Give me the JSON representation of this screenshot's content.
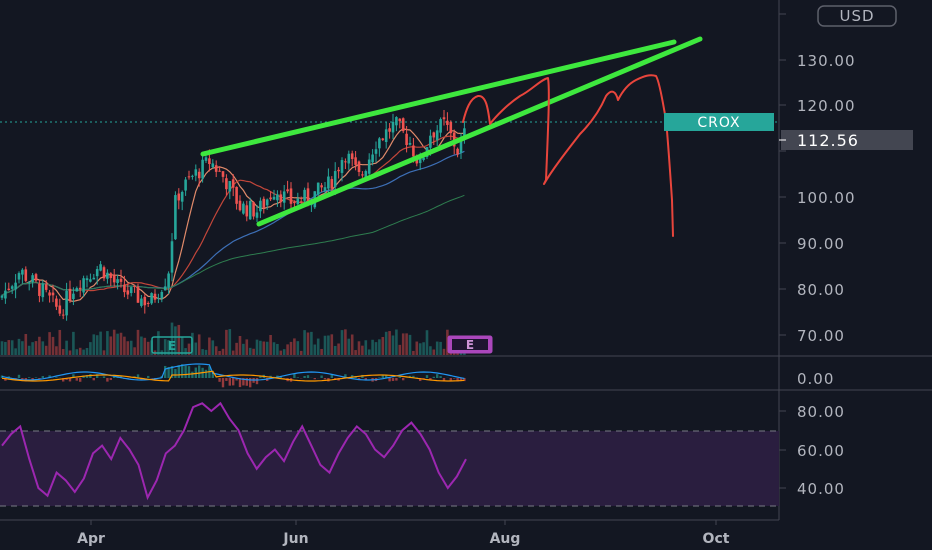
{
  "currency": "USD",
  "ticker_label": "CROX",
  "last_price": "112.56",
  "earnings_marker": "E",
  "colors": {
    "background": "#131722",
    "up": "#26a69a",
    "down": "#ef5350",
    "wedge": "#3ee83e",
    "projection": "#e8453c",
    "ticker_bg": "#26a69a",
    "rsi": "#9c27b0",
    "rsi_band": "#2a1e3f",
    "ma_fast": "#e08a6a",
    "ma_mid": "#c2463a",
    "ma_blue": "#3d6fb6",
    "ma_slow": "#2e7d4f",
    "earnings_green": "#26a69a",
    "earnings_purple": "#ab47bc"
  },
  "chart_data": [
    {
      "type": "candlestick",
      "price_axis": {
        "ticks": [
          "130.00",
          "120.00",
          "110.00",
          "100.00",
          "90.00",
          "80.00",
          "70.00"
        ],
        "range": [
          65,
          142
        ]
      },
      "time_axis": [
        "Apr",
        "Jun",
        "Aug",
        "Oct"
      ],
      "last_value": 112.56,
      "indicators": [
        "moving averages",
        "volume"
      ],
      "annotations": [
        "rising wedge trendlines",
        "hand-drawn projected price path"
      ]
    },
    {
      "type": "line",
      "indicator": "MACD",
      "axis_tick": "0.00"
    },
    {
      "type": "line",
      "indicator": "RSI",
      "axis_ticks": [
        "80.00",
        "60.00",
        "40.00"
      ],
      "range": [
        25,
        90
      ],
      "band": [
        30,
        70
      ],
      "values": [
        62,
        68,
        72,
        55,
        40,
        36,
        48,
        44,
        38,
        45,
        58,
        62,
        55,
        66,
        60,
        52,
        35,
        44,
        58,
        62,
        70,
        82,
        84,
        80,
        84,
        76,
        70,
        58,
        50,
        56,
        60,
        54,
        64,
        72,
        62,
        52,
        48,
        58,
        66,
        72,
        68,
        60,
        56,
        62,
        70,
        74,
        68,
        60,
        48,
        40,
        46,
        55
      ]
    }
  ]
}
